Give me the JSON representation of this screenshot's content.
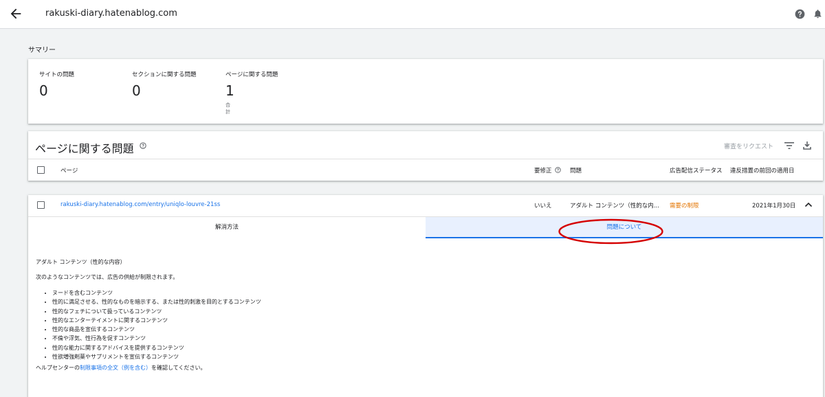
{
  "header": {
    "site": "rakuski-diary.hatenablog.com"
  },
  "summary": {
    "label": "サマリー",
    "stats": [
      {
        "label": "サイトの問題",
        "value": "0"
      },
      {
        "label": "セクションに関する問題",
        "value": "0"
      },
      {
        "label": "ページに関する問題",
        "value": "1",
        "sub": "合計"
      }
    ]
  },
  "issues": {
    "title": "ページに関する問題",
    "request_review": "審査をリクエスト",
    "columns": {
      "page": "ページ",
      "needs_fix": "要修正",
      "issue": "問題",
      "ad_status": "広告配信ステータス",
      "last_enforced": "違反措置の前回の適用日"
    }
  },
  "row": {
    "url": "rakuski-diary.hatenablog.com/entry/uniqlo-louvre-21ss",
    "needs_fix": "いいえ",
    "issue": "アダルト コンテンツ（性的な内...",
    "status": "需要の制限",
    "date": "2021年1月30日"
  },
  "tabs": {
    "resolve": "解消方法",
    "about": "問題について"
  },
  "content": {
    "title": "アダルト コンテンツ（性的な内容）",
    "intro": "次のようなコンテンツでは、広告の供給が制限されます。",
    "bullets": [
      "ヌードを含むコンテンツ",
      "性的に満足させる、性的なものを暗示する、または性的刺激を目的とするコンテンツ",
      "性的なフェチについて扱っているコンテンツ",
      "性的なエンターテイメントに関するコンテンツ",
      "性的な商品を宣伝するコンテンツ",
      "不倫や浮気、性行為を促すコンテンツ",
      "性的な能力に関するアドバイスを提供するコンテンツ",
      "性欲増強剤薬やサプリメントを宣伝するコンテンツ"
    ],
    "footer_prefix": "ヘルプセンターの",
    "footer_link": "制限事項の全文（例を含む）",
    "footer_suffix": "を確認してください。"
  },
  "colors": {
    "accent": "#1a73e8",
    "status_orange": "#e37400",
    "annotation_red": "#d50000"
  }
}
